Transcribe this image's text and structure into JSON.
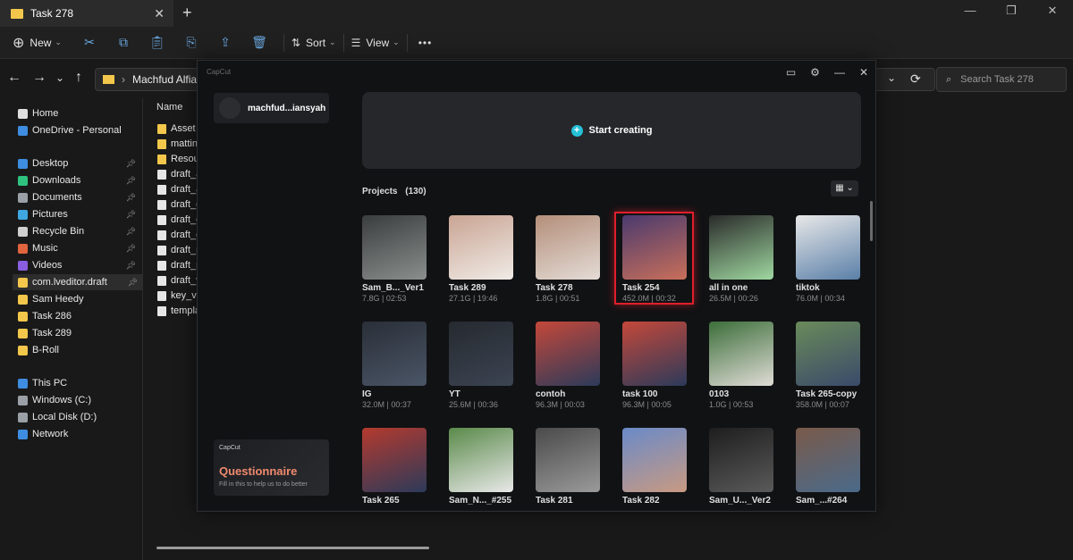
{
  "explorer": {
    "tab_title": "Task 278",
    "new_tab": "+",
    "toolbar": {
      "new_label": "New",
      "sort_label": "Sort",
      "view_label": "View",
      "more": "•••"
    },
    "address": "Machfud Alfiansyah",
    "search_placeholder": "Search Task 278",
    "sidebar": [
      {
        "label": "Home",
        "icon": "home-icon",
        "color": "#e0e0e0"
      },
      {
        "label": "OneDrive - Personal",
        "icon": "cloud-icon",
        "color": "#3e8de0"
      },
      {
        "label": "Desktop",
        "icon": "desktop-icon",
        "color": "#3e8de0",
        "pinned": true
      },
      {
        "label": "Downloads",
        "icon": "download-icon",
        "color": "#2ec27e",
        "pinned": true
      },
      {
        "label": "Documents",
        "icon": "document-icon",
        "color": "#9aa0a6",
        "pinned": true
      },
      {
        "label": "Pictures",
        "icon": "picture-icon",
        "color": "#3ea6e0",
        "pinned": true
      },
      {
        "label": "Recycle Bin",
        "icon": "recycle-bin-icon",
        "color": "#cfcfcf",
        "pinned": true
      },
      {
        "label": "Music",
        "icon": "music-icon",
        "color": "#e0643e",
        "pinned": true
      },
      {
        "label": "Videos",
        "icon": "video-icon",
        "color": "#8a5ee0",
        "pinned": true
      },
      {
        "label": "com.lveditor.draft",
        "icon": "folder-icon",
        "color": "#f2c74b",
        "pinned": true,
        "selected": true
      },
      {
        "label": "Sam Heedy",
        "icon": "folder-icon",
        "color": "#f2c74b"
      },
      {
        "label": "Task 286",
        "icon": "folder-icon",
        "color": "#f2c74b"
      },
      {
        "label": "Task 289",
        "icon": "folder-icon",
        "color": "#f2c74b"
      },
      {
        "label": "B-Roll",
        "icon": "folder-icon",
        "color": "#f2c74b"
      },
      {
        "label": "This PC",
        "icon": "pc-icon",
        "color": "#3e8de0"
      },
      {
        "label": "Windows (C:)",
        "icon": "drive-icon",
        "color": "#9aa0a6"
      },
      {
        "label": "Local Disk (D:)",
        "icon": "drive-icon",
        "color": "#9aa0a6"
      },
      {
        "label": "Network",
        "icon": "network-icon",
        "color": "#3e8de0"
      }
    ],
    "column_name": "Name",
    "files": [
      {
        "name": "Asset",
        "type": "folder"
      },
      {
        "name": "matting",
        "type": "folder"
      },
      {
        "name": "Resour",
        "type": "folder"
      },
      {
        "name": "draft_a",
        "type": "file"
      },
      {
        "name": "draft_a",
        "type": "file"
      },
      {
        "name": "draft_c",
        "type": "file"
      },
      {
        "name": "draft_c",
        "type": "file"
      },
      {
        "name": "draft_c",
        "type": "file"
      },
      {
        "name": "draft_n",
        "type": "file"
      },
      {
        "name": "draft_s",
        "type": "file"
      },
      {
        "name": "draft_v",
        "type": "file"
      },
      {
        "name": "key_val",
        "type": "file"
      },
      {
        "name": "templa",
        "type": "file"
      }
    ]
  },
  "capcut": {
    "logo": "CapCut",
    "user": "machfud...iansyah",
    "start_label": "Start creating",
    "projects_label": "Projects",
    "projects_count": "(130)",
    "questionnaire": {
      "logo": "CapCut",
      "title": "Questionnaire",
      "subtitle": "Fill in this to help us to do better"
    },
    "projects": [
      {
        "name": "Sam_B..._Ver1",
        "meta": "7.8G | 02:53",
        "colors": [
          "#3a3d3e",
          "#8a8f8d"
        ]
      },
      {
        "name": "Task 289",
        "meta": "27.1G | 19:46",
        "colors": [
          "#c9a493",
          "#f0ebe6"
        ]
      },
      {
        "name": "Task 278",
        "meta": "1.8G | 00:51",
        "colors": [
          "#b48e7a",
          "#e4dcd6"
        ]
      },
      {
        "name": "Task 254",
        "meta": "452.0M | 00:32",
        "colors": [
          "#4a3a6e",
          "#c96f5a"
        ],
        "highlighted": true
      },
      {
        "name": "all in one",
        "meta": "26.5M | 00:26",
        "colors": [
          "#2a2a2a",
          "#9fd8a0"
        ]
      },
      {
        "name": "tiktok",
        "meta": "76.0M | 00:34",
        "colors": [
          "#e8e8e8",
          "#5a7fa8"
        ]
      },
      {
        "name": "IG",
        "meta": "32.0M | 00:37",
        "colors": [
          "#2a2f38",
          "#4a5566"
        ]
      },
      {
        "name": "YT",
        "meta": "25.6M | 00:36",
        "colors": [
          "#262a30",
          "#3c4452"
        ]
      },
      {
        "name": "contoh",
        "meta": "96.3M | 00:03",
        "colors": [
          "#c4483a",
          "#2c3a5a"
        ]
      },
      {
        "name": "task 100",
        "meta": "96.3M | 00:05",
        "colors": [
          "#c4483a",
          "#2c3a5a"
        ]
      },
      {
        "name": "0103",
        "meta": "1.0G | 00:53",
        "colors": [
          "#3c6e3a",
          "#e0dcd6"
        ]
      },
      {
        "name": "Task 265-copy",
        "meta": "358.0M | 00:07",
        "colors": [
          "#6a8a5a",
          "#3a4a6a"
        ]
      },
      {
        "name": "Task 265",
        "meta": "",
        "colors": [
          "#b43a2e",
          "#2c3a5a"
        ]
      },
      {
        "name": "Sam_N..._#255",
        "meta": "",
        "colors": [
          "#5a8a4a",
          "#e8e8e8"
        ]
      },
      {
        "name": "Task 281",
        "meta": "",
        "colors": [
          "#4a4a4a",
          "#9a9a9a"
        ]
      },
      {
        "name": "Task 282",
        "meta": "",
        "colors": [
          "#6a8ac8",
          "#c89a82"
        ]
      },
      {
        "name": "Sam_U..._Ver2",
        "meta": "",
        "colors": [
          "#1e1e1e",
          "#5a5a5a"
        ]
      },
      {
        "name": "Sam_...#264",
        "meta": "",
        "colors": [
          "#7a5a4a",
          "#4a6a8a"
        ]
      }
    ]
  }
}
